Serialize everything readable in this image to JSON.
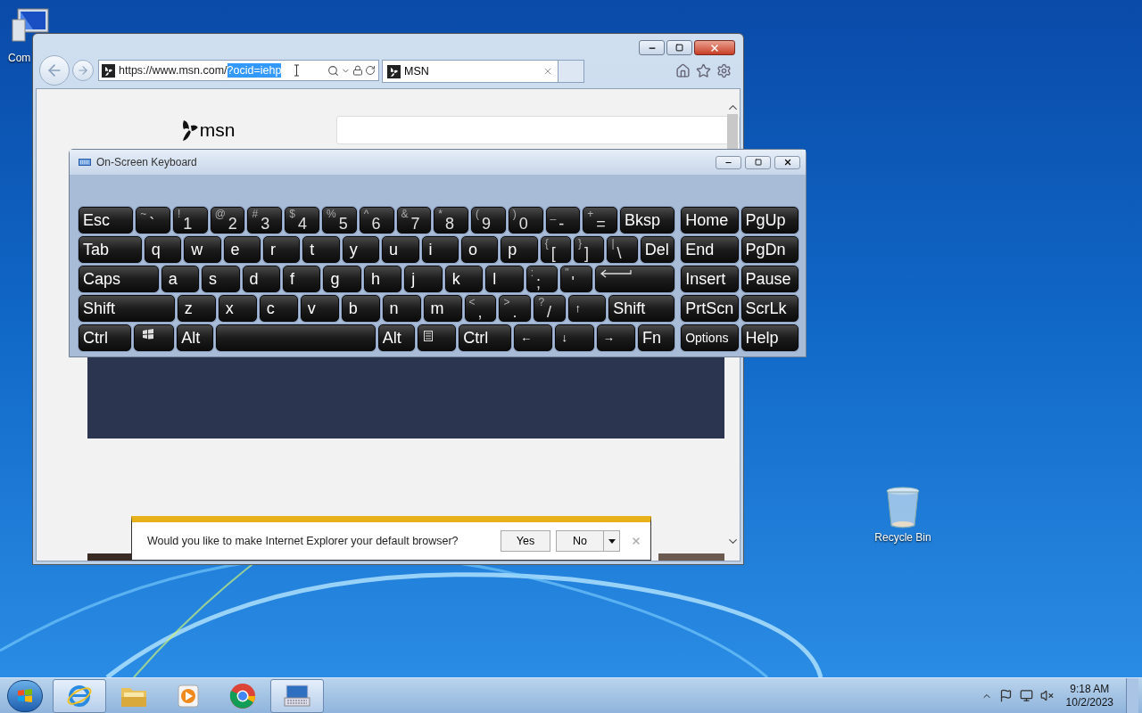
{
  "desktop": {
    "icons": [
      {
        "kind": "computer",
        "label": "Com"
      },
      {
        "kind": "recycle",
        "label": "Recycle Bin"
      }
    ]
  },
  "browser": {
    "address": {
      "url": "https://www.msn.com/",
      "selected_text": "?ocid=iehp"
    },
    "tabs": [
      {
        "label": "MSN",
        "selected": true
      }
    ],
    "logo_text": "msn",
    "notification": {
      "message": "Would you like to make Internet Explorer your default browser?",
      "buttons": [
        "Yes",
        "No"
      ]
    }
  },
  "keyboard": {
    "title": "On-Screen Keyboard",
    "key_rows": [
      {
        "keys": [
          {
            "kind": "label",
            "label": "Esc"
          },
          {
            "kind": "char",
            "top": "~",
            "main": "`"
          },
          {
            "kind": "char",
            "top": "!",
            "main": "1"
          },
          {
            "kind": "char",
            "top": "@",
            "main": "2"
          },
          {
            "kind": "char",
            "top": "#",
            "main": "3"
          },
          {
            "kind": "char",
            "top": "$",
            "main": "4"
          },
          {
            "kind": "char",
            "top": "%",
            "main": "5"
          },
          {
            "kind": "char",
            "top": "^",
            "main": "6"
          },
          {
            "kind": "char",
            "top": "&",
            "main": "7"
          },
          {
            "kind": "char",
            "top": "*",
            "main": "8"
          },
          {
            "kind": "char",
            "top": "(",
            "main": "9"
          },
          {
            "kind": "char",
            "top": ")",
            "main": "0"
          },
          {
            "kind": "char",
            "top": "_",
            "main": "-"
          },
          {
            "kind": "char",
            "top": "+",
            "main": "="
          },
          {
            "kind": "label",
            "label": "Bksp"
          }
        ]
      },
      {
        "keys": [
          {
            "kind": "label",
            "label": "Tab"
          },
          {
            "kind": "letter",
            "label": "q"
          },
          {
            "kind": "letter",
            "label": "w"
          },
          {
            "kind": "letter",
            "label": "e"
          },
          {
            "kind": "letter",
            "label": "r"
          },
          {
            "kind": "letter",
            "label": "t"
          },
          {
            "kind": "letter",
            "label": "y"
          },
          {
            "kind": "letter",
            "label": "u"
          },
          {
            "kind": "letter",
            "label": "i"
          },
          {
            "kind": "letter",
            "label": "o"
          },
          {
            "kind": "letter",
            "label": "p"
          },
          {
            "kind": "char",
            "top": "{",
            "main": "["
          },
          {
            "kind": "char",
            "top": "}",
            "main": "]"
          },
          {
            "kind": "char",
            "top": "|",
            "main": "\\"
          },
          {
            "kind": "label",
            "label": "Del"
          }
        ]
      },
      {
        "keys": [
          {
            "kind": "label",
            "label": "Caps"
          },
          {
            "kind": "letter",
            "label": "a"
          },
          {
            "kind": "letter",
            "label": "s"
          },
          {
            "kind": "letter",
            "label": "d"
          },
          {
            "kind": "letter",
            "label": "f"
          },
          {
            "kind": "letter",
            "label": "g"
          },
          {
            "kind": "letter",
            "label": "h"
          },
          {
            "kind": "letter",
            "label": "j"
          },
          {
            "kind": "letter",
            "label": "k"
          },
          {
            "kind": "letter",
            "label": "l"
          },
          {
            "kind": "char",
            "top": ":",
            "main": ";"
          },
          {
            "kind": "char",
            "top": "\"",
            "main": "'"
          },
          {
            "kind": "enter"
          }
        ]
      },
      {
        "keys": [
          {
            "kind": "label",
            "label": "Shift"
          },
          {
            "kind": "letter",
            "label": "z"
          },
          {
            "kind": "letter",
            "label": "x"
          },
          {
            "kind": "letter",
            "label": "c"
          },
          {
            "kind": "letter",
            "label": "v"
          },
          {
            "kind": "letter",
            "label": "b"
          },
          {
            "kind": "letter",
            "label": "n"
          },
          {
            "kind": "letter",
            "label": "m"
          },
          {
            "kind": "char",
            "top": "<",
            "main": ","
          },
          {
            "kind": "char",
            "top": ">",
            "main": "."
          },
          {
            "kind": "char",
            "top": "?",
            "main": "/"
          },
          {
            "kind": "arrow",
            "label": "↑"
          },
          {
            "kind": "label",
            "label": "Shift"
          }
        ]
      },
      {
        "keys": [
          {
            "kind": "label",
            "label": "Ctrl"
          },
          {
            "kind": "win"
          },
          {
            "kind": "label",
            "label": "Alt"
          },
          {
            "kind": "space"
          },
          {
            "kind": "label",
            "label": "Alt"
          },
          {
            "kind": "menu"
          },
          {
            "kind": "label",
            "label": "Ctrl"
          },
          {
            "kind": "arrow",
            "label": "←"
          },
          {
            "kind": "arrow",
            "label": "↓"
          },
          {
            "kind": "arrow",
            "label": "→"
          },
          {
            "kind": "label",
            "label": "Fn"
          }
        ]
      }
    ],
    "nav_key_rows": [
      {
        "keys": [
          {
            "kind": "label",
            "label": "Home"
          },
          {
            "kind": "label",
            "label": "PgUp"
          }
        ]
      },
      {
        "keys": [
          {
            "kind": "label",
            "label": "End"
          },
          {
            "kind": "label",
            "label": "PgDn"
          }
        ]
      },
      {
        "keys": [
          {
            "kind": "label",
            "label": "Insert"
          },
          {
            "kind": "label",
            "label": "Pause"
          }
        ]
      },
      {
        "keys": [
          {
            "kind": "label",
            "label": "PrtScn"
          },
          {
            "kind": "label",
            "label": "ScrLk"
          }
        ]
      },
      {
        "keys": [
          {
            "kind": "small",
            "label": "Options"
          },
          {
            "kind": "label",
            "label": "Help"
          }
        ]
      }
    ]
  },
  "taskbar": {
    "items": [
      {
        "kind": "ie",
        "selected": true
      },
      {
        "kind": "folder",
        "selected": false
      },
      {
        "kind": "media",
        "selected": false
      },
      {
        "kind": "chrome",
        "selected": false
      },
      {
        "kind": "keyboard",
        "selected": true
      }
    ]
  },
  "tray": {
    "time": "9:18 AM",
    "date": "10/2/2023"
  }
}
